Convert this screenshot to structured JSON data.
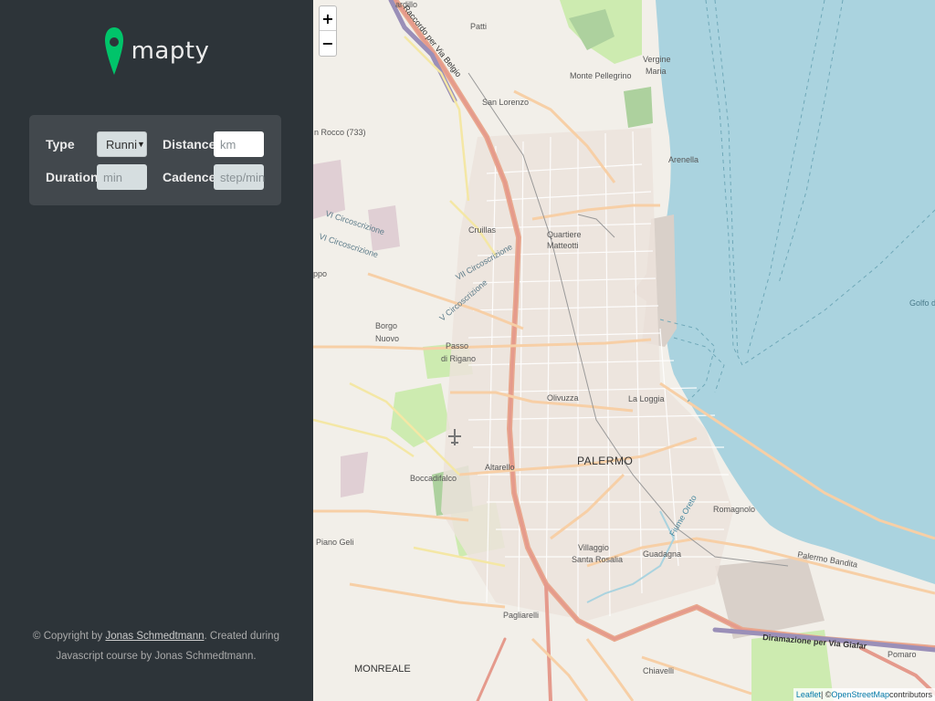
{
  "app": {
    "name": "mapty"
  },
  "form": {
    "type_label": "Type",
    "type_value": "Runni",
    "distance_label": "Distance",
    "distance_placeholder": "km",
    "duration_label": "Duration",
    "duration_placeholder": "min",
    "cadence_label": "Cadence",
    "cadence_placeholder": "step/min"
  },
  "footer": {
    "prefix": "© Copyright by ",
    "author_link": "Jonas Schmedtmann",
    "suffix": ". Created during Javascript course by Jonas Schmedtmann."
  },
  "map": {
    "zoom_in": "+",
    "zoom_out": "−",
    "attribution_leaflet": "Leaflet",
    "attribution_sep": " | © ",
    "attribution_osm": "OpenStreetMap",
    "attribution_suffix": " contributors",
    "labels": {
      "palermo": "PALERMO",
      "monreale": "MONREALE",
      "partanna": "Patti",
      "monte_pellegrino": "Monte Pellegrino",
      "san_lorenzo": "San Lorenzo",
      "arenella": "Arenella",
      "cruillas": "Cruillas",
      "quartiere": "Quartiere",
      "matteotti": "Matteotti",
      "borgo": "Borgo",
      "nuovo": "Nuovo",
      "passo": "Passo",
      "di_rigano": "di Rigano",
      "olivuzza": "Olivuzza",
      "la_loggia": "La Loggia",
      "altarello": "Altarello",
      "boccadifalco": "Boccadifalco",
      "piano_geli": "Piano Geli",
      "villaggio": "Villaggio",
      "santa_rosalia": "Santa Rosalia",
      "guadagna": "Guadagna",
      "romagnolo": "Romagnolo",
      "palermo_bandita": "Palermo Bandita",
      "pagliarelli": "Pagliarelli",
      "chiavelli": "Chiavelli",
      "golfo": "Golfo di",
      "vergine": "Vergine",
      "maria": "Maria",
      "san_rocco": "n Rocco (733)",
      "vi_circ_1": "VI Circoscrizione",
      "vi_circ_2": "VI Circoscrizione",
      "vii_circ": "VII Circoscrizione",
      "v_circ": "V Circoscrizione",
      "raccordo": "Raccordo per Via Belgio",
      "diramazione": "Diramazione per Via Giafar",
      "fiume": "Fiume Oreto",
      "pomaro": "Pomaro",
      "cardillo": "ardillo",
      "pollo": "ppo"
    }
  }
}
